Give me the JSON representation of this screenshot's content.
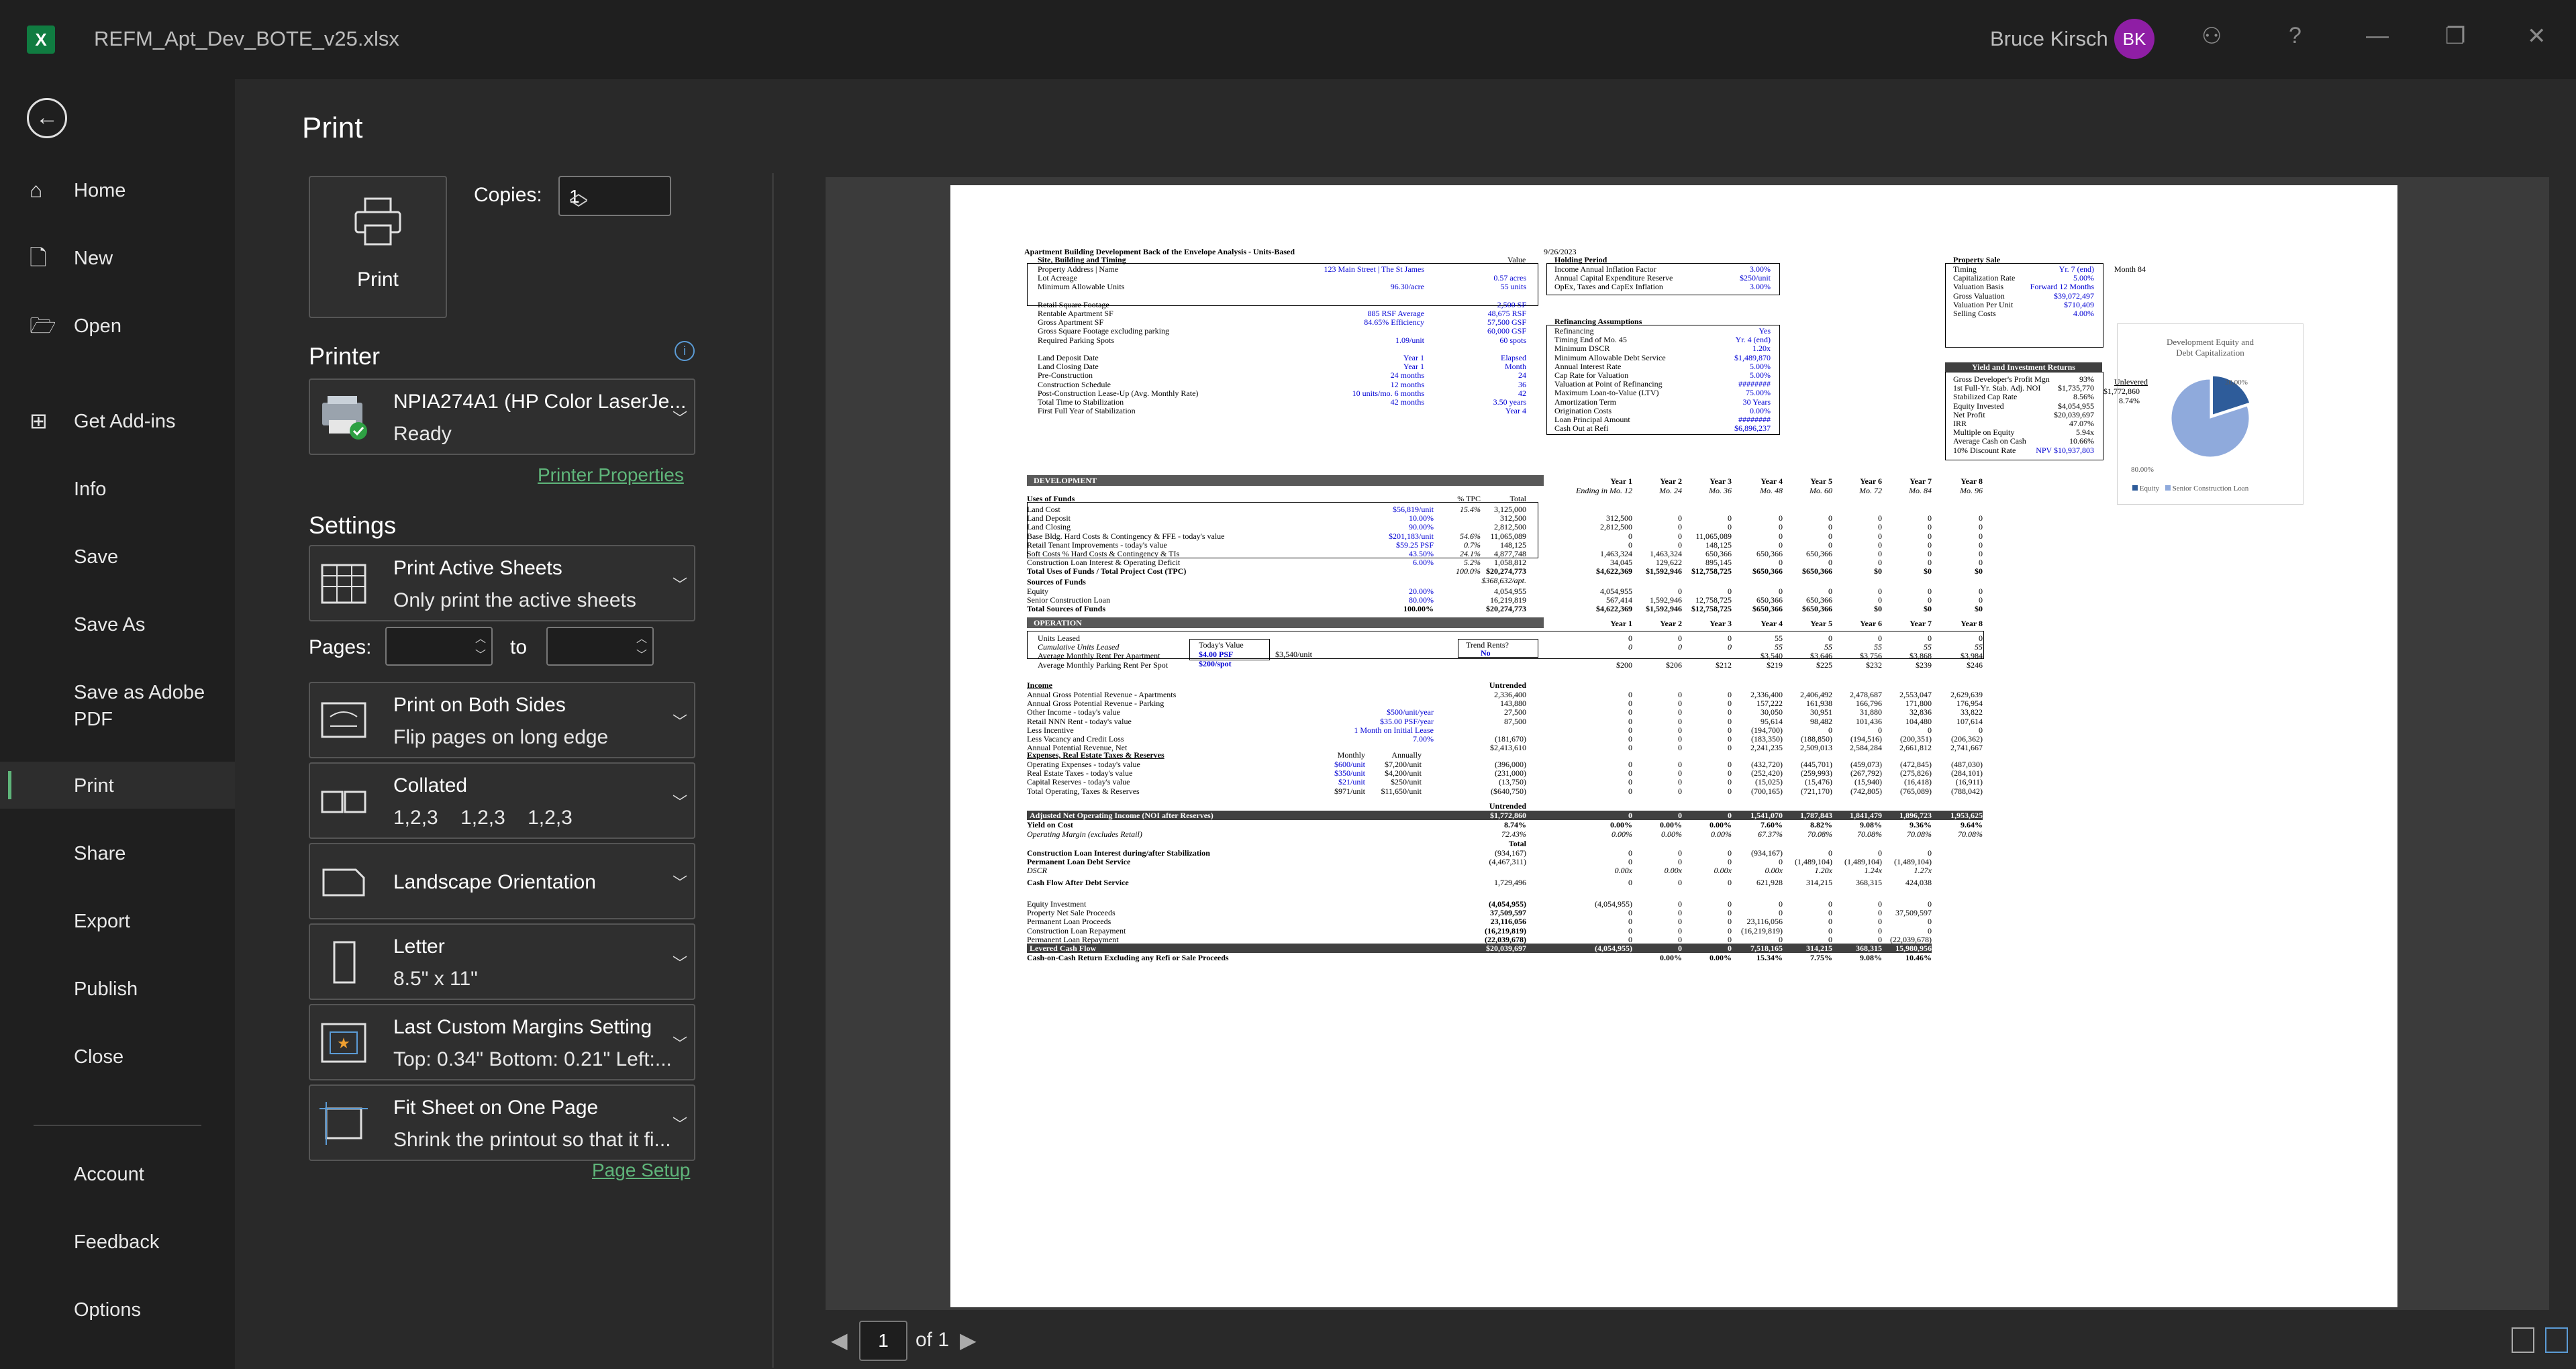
{
  "window": {
    "title": "REFM_Apt_Dev_BOTE_v25.xlsx",
    "user_name": "Bruce Kirsch",
    "user_initials": "BK",
    "help_glyph": "?",
    "minimize_glyph": "—",
    "restore_glyph": "❐",
    "close_glyph": "✕"
  },
  "nav": {
    "back_glyph": "←",
    "items": [
      {
        "label": "Home",
        "icon": "home-icon"
      },
      {
        "label": "New",
        "icon": "new-doc-icon"
      },
      {
        "label": "Open",
        "icon": "open-folder-icon"
      },
      {
        "label": "Get Add-ins",
        "icon": "add-ins-icon"
      },
      {
        "label": "Info"
      },
      {
        "label": "Save"
      },
      {
        "label": "Save As"
      },
      {
        "label": "Save as Adobe",
        "label2": "PDF"
      },
      {
        "label": "Print"
      },
      {
        "label": "Share"
      },
      {
        "label": "Export"
      },
      {
        "label": "Publish"
      },
      {
        "label": "Close"
      },
      {
        "label": "Account"
      },
      {
        "label": "Feedback"
      },
      {
        "label": "Options"
      }
    ]
  },
  "print": {
    "heading": "Print",
    "button_label": "Print",
    "copies_label": "Copies:",
    "copies_value": "1",
    "printer_heading": "Printer",
    "printer_name": "NPIA274A1 (HP Color LaserJe...",
    "printer_status": "Ready",
    "printer_properties": "Printer Properties",
    "settings_heading": "Settings",
    "pages_label": "Pages:",
    "to_label": "to",
    "settings": [
      {
        "title": "Print Active Sheets",
        "sub": "Only print the active sheets"
      },
      {
        "title": "Print on Both Sides",
        "sub": "Flip pages on long edge"
      },
      {
        "title": "Collated",
        "sub": "1,2,3    1,2,3    1,2,3"
      },
      {
        "title": "Landscape Orientation",
        "sub": ""
      },
      {
        "title": "Letter",
        "sub": "8.5\" x 11\""
      },
      {
        "title": "Last Custom Margins Setting",
        "sub": "Top: 0.34\" Bottom: 0.21\" Left:..."
      },
      {
        "title": "Fit Sheet on One Page",
        "sub": "Shrink the printout so that it fi..."
      }
    ],
    "page_setup": "Page Setup",
    "page_current": "1",
    "page_of": "of 1"
  },
  "sheet": {
    "title": "Apartment Building Development Back of the Envelope Analysis - Units-Based",
    "date": "9/26/2023",
    "site_header": "Site, Building and Timing",
    "value_header": "Value",
    "site_rows": [
      [
        "Property Address | Name",
        "123 Main Street | The St James",
        ""
      ],
      [
        "Lot Acreage",
        "",
        "0.57 acres"
      ],
      [
        "Minimum Allowable Units",
        "96.30/acre",
        "55 units"
      ],
      [
        "",
        "",
        ""
      ],
      [
        "Retail Square Footage",
        "",
        "2,500 SF"
      ],
      [
        "Rentable Apartment SF",
        "885 RSF  Average",
        "48,675 RSF"
      ],
      [
        "Gross Apartment SF",
        "84.65%  Efficiency",
        "57,500 GSF"
      ],
      [
        "Gross Square Footage excluding parking",
        "",
        "60,000 GSF"
      ],
      [
        "Required Parking Spots",
        "1.09/unit",
        "60 spots"
      ],
      [
        "",
        "",
        ""
      ],
      [
        "Land Deposit Date",
        "Year 1",
        "Elapsed"
      ],
      [
        "Land Closing Date",
        "Year 1",
        "Month"
      ],
      [
        "Pre-Construction",
        "24 months",
        "24"
      ],
      [
        "Construction Schedule",
        "12 months",
        "36"
      ],
      [
        "Post-Construction Lease-Up (Avg. Monthly Rate)",
        "10 units/mo.  6 months",
        "42"
      ],
      [
        "Total Time to Stabilization",
        "42 months",
        "3.50 years"
      ],
      [
        "First Full Year of Stabilization",
        "",
        "Year 4"
      ]
    ],
    "holding_header": "Holding Period",
    "holding_rows": [
      [
        "Income Annual Inflation Factor",
        "3.00%"
      ],
      [
        "Annual Capital Expenditure Reserve",
        "$250/unit"
      ],
      [
        "OpEx, Taxes and CapEx Inflation",
        "3.00%"
      ]
    ],
    "refi_header": "Refinancing Assumptions",
    "refi_rows": [
      [
        "Refinancing",
        "Yes"
      ],
      [
        "Timing    End of Mo. 45",
        "Yr. 4  (end)"
      ],
      [
        "Minimum DSCR",
        "1.20x"
      ],
      [
        "Minimum Allowable Debt Service",
        "$1,489,870"
      ],
      [
        "Annual Interest Rate",
        "5.00%"
      ],
      [
        "Cap Rate for Valuation",
        "5.00%"
      ],
      [
        "Valuation at Point of Refinancing",
        "########"
      ],
      [
        "Maximum Loan-to-Value (LTV)",
        "75.00%"
      ],
      [
        "Amortization Term",
        "30 Years"
      ],
      [
        "Origination Costs",
        "0.00%"
      ],
      [
        "Loan Principal Amount",
        "########"
      ],
      [
        "Cash Out at Refi",
        "$6,896,237"
      ]
    ],
    "sale_header": "Property Sale",
    "sale_rows": [
      [
        "Timing",
        "Yr. 7 (end)"
      ],
      [
        "Capitalization Rate",
        "5.00%"
      ],
      [
        "Valuation Basis",
        "Forward 12 Months"
      ],
      [
        "Gross Valuation",
        "$39,072,497"
      ],
      [
        "Valuation Per Unit",
        "$710,409"
      ],
      [
        "Selling Costs",
        "4.00%"
      ]
    ],
    "month_note": "Month 84",
    "yield_header": "Yield and Investment Returns",
    "unlevered_label": "Unlevered",
    "yield_rows": [
      [
        "Gross Developer's Profit Mgn",
        "93%"
      ],
      [
        "1st Full-Yr. Stab. Adj. NOI",
        "$1,735,770"
      ],
      [
        "Stabilized Cap Rate",
        "8.56%"
      ],
      [
        "Equity Invested",
        "$4,054,955"
      ],
      [
        "Net Profit",
        "$20,039,697"
      ],
      [
        "IRR",
        "47.07%"
      ],
      [
        "Multiple on Equity",
        "5.94x"
      ],
      [
        "Average Cash on Cash",
        "10.66%"
      ],
      [
        "10% Discount Rate",
        "NPV $10,937,803"
      ]
    ],
    "unlev_values": [
      "$1,772,860",
      "8.74%"
    ],
    "dev_header": "DEVELOPMENT",
    "year_headers": [
      "Year 1",
      "Year 2",
      "Year 3",
      "Year 4",
      "Year 5",
      "Year 6",
      "Year 7",
      "Year 8"
    ],
    "month_sub": [
      "Ending in Mo. 12",
      "Mo. 24",
      "Mo. 36",
      "Mo. 48",
      "Mo. 60",
      "Mo. 72",
      "Mo. 84",
      "Mo. 96"
    ],
    "uses_header": "Uses of Funds",
    "pct_tpc": "% TPC",
    "total_label": "Total",
    "uses_rows": [
      [
        "Land Cost",
        "$56,819/unit",
        "15.4%",
        "3,125,000",
        [
          "",
          "",
          "",
          "",
          "",
          "",
          "",
          ""
        ]
      ],
      [
        "  Land Deposit",
        "10.00%",
        "",
        "312,500",
        [
          "312,500",
          "0",
          "0",
          "0",
          "0",
          "0",
          "0",
          "0"
        ]
      ],
      [
        "  Land Closing",
        "90.00%",
        "",
        "2,812,500",
        [
          "2,812,500",
          "0",
          "0",
          "0",
          "0",
          "0",
          "0",
          "0"
        ]
      ],
      [
        "Base Bldg. Hard Costs & Contingency & FFE - today's value",
        "$201,183/unit",
        "54.6%",
        "11,065,089",
        [
          "0",
          "0",
          "11,065,089",
          "0",
          "0",
          "0",
          "0",
          "0"
        ]
      ],
      [
        "Retail Tenant Improvements - today's value",
        "$59.25 PSF",
        "0.7%",
        "148,125",
        [
          "0",
          "0",
          "148,125",
          "0",
          "0",
          "0",
          "0",
          "0"
        ]
      ],
      [
        "Soft Costs % Hard Costs & Contingency & TIs",
        "43.50%",
        "24.1%",
        "4,877,748",
        [
          "1,463,324",
          "1,463,324",
          "650,366",
          "650,366",
          "650,366",
          "0",
          "0",
          "0"
        ]
      ],
      [
        "Construction Loan Interest & Operating Deficit",
        "6.00%",
        "5.2%",
        "1,058,812",
        [
          "34,045",
          "129,622",
          "895,145",
          "0",
          "0",
          "0",
          "0",
          "0"
        ]
      ],
      [
        "Total Uses of Funds / Total Project Cost (TPC)",
        "",
        "100.0%",
        "$20,274,773",
        [
          "$4,622,369",
          "$1,592,946",
          "$12,758,725",
          "$650,366",
          "$650,366",
          "$0",
          "$0",
          "$0"
        ]
      ]
    ],
    "tpc_per_unit": "$368,632/apt.",
    "sources_header": "Sources of Funds",
    "sources_rows": [
      [
        "Equity",
        "20.00%",
        "4,054,955",
        [
          "4,054,955",
          "0",
          "0",
          "0",
          "0",
          "0",
          "0",
          "0"
        ]
      ],
      [
        "Senior Construction Loan",
        "80.00%",
        "16,219,819",
        [
          "567,414",
          "1,592,946",
          "12,758,725",
          "650,366",
          "650,366",
          "0",
          "0",
          "0"
        ]
      ],
      [
        "Total Sources of Funds",
        "100.00%",
        "$20,274,773",
        [
          "$4,622,369",
          "$1,592,946",
          "$12,758,725",
          "$650,366",
          "$650,366",
          "$0",
          "$0",
          "$0"
        ]
      ]
    ],
    "op_header": "OPERATION",
    "lease_rows": [
      [
        "Units Leased",
        [
          "0",
          "0",
          "0",
          "55",
          "0",
          "0",
          "0",
          "0"
        ]
      ],
      [
        "Cumulative Units Leased",
        [
          "0",
          "0",
          "0",
          "55",
          "55",
          "55",
          "55",
          "55"
        ]
      ],
      [
        "Average Monthly Rent Per Apartment",
        [
          "",
          "",
          "",
          "$3,540",
          "$3,646",
          "$3,756",
          "$3,868",
          "$3,984"
        ]
      ],
      [
        "Average Monthly Parking Rent Per Spot",
        [
          "$200",
          "$206",
          "$212",
          "$219",
          "$225",
          "$232",
          "$239",
          "$246"
        ]
      ]
    ],
    "todays_value": "Today's Value",
    "rent_psf": "$4.00 PSF",
    "rent_unit": "$3,540/unit",
    "parking_rent": "$200/spot",
    "trend_rents": "Trend Rents?",
    "trend_no": "No",
    "income_header": "Income",
    "untrended": "Untrended",
    "income_rows": [
      [
        "Annual Gross Potential Revenue - Apartments",
        "",
        "2,336,400",
        [
          "0",
          "0",
          "0",
          "2,336,400",
          "2,406,492",
          "2,478,687",
          "2,553,047",
          "2,629,639"
        ]
      ],
      [
        "Annual Gross Potential Revenue - Parking",
        "",
        "143,880",
        [
          "0",
          "0",
          "0",
          "157,222",
          "161,938",
          "166,796",
          "171,800",
          "176,954"
        ]
      ],
      [
        "Other Income - today's value",
        "$500/unit/year",
        "27,500",
        [
          "0",
          "0",
          "0",
          "30,050",
          "30,951",
          "31,880",
          "32,836",
          "33,822"
        ]
      ],
      [
        "Retail NNN Rent - today's value",
        "$35.00 PSF/year",
        "87,500",
        [
          "0",
          "0",
          "0",
          "95,614",
          "98,482",
          "101,436",
          "104,480",
          "107,614"
        ]
      ],
      [
        "Less Incentive",
        "1 Month on Initial Lease",
        "",
        [
          "0",
          "0",
          "0",
          "(194,700)",
          "0",
          "0",
          "0",
          "0"
        ]
      ],
      [
        "Less Vacancy and Credit Loss",
        "7.00%",
        "(181,670)",
        [
          "0",
          "0",
          "0",
          "(183,350)",
          "(188,850)",
          "(194,516)",
          "(200,351)",
          "(206,362)"
        ]
      ],
      [
        "Annual Potential Revenue, Net",
        "",
        "$2,413,610",
        [
          "0",
          "0",
          "0",
          "2,241,235",
          "2,509,013",
          "2,584,284",
          "2,661,812",
          "2,741,667"
        ]
      ]
    ],
    "exp_header": "Expenses, Real Estate Taxes & Reserves",
    "monthly": "Monthly",
    "annually": "Annually",
    "exp_rows": [
      [
        "Operating Expenses - today's value",
        "$600/unit",
        "$7,200/unit",
        "(396,000)",
        [
          "0",
          "0",
          "0",
          "(432,720)",
          "(445,701)",
          "(459,073)",
          "(472,845)",
          "(487,030)"
        ]
      ],
      [
        "Real Estate Taxes - today's value",
        "$350/unit",
        "$4,200/unit",
        "(231,000)",
        [
          "0",
          "0",
          "0",
          "(252,420)",
          "(259,993)",
          "(267,792)",
          "(275,826)",
          "(284,101)"
        ]
      ],
      [
        "Capital Reserves - today's value",
        "$21/unit",
        "$250/unit",
        "(13,750)",
        [
          "0",
          "0",
          "0",
          "(15,025)",
          "(15,476)",
          "(15,940)",
          "(16,418)",
          "(16,911)"
        ]
      ],
      [
        "Total Operating, Taxes & Reserves",
        "$971/unit",
        "$11,650/unit",
        "($640,750)",
        [
          "0",
          "0",
          "0",
          "(700,165)",
          "(721,170)",
          "(742,805)",
          "(765,089)",
          "(788,042)"
        ]
      ]
    ],
    "untrended2": "Untrended",
    "noi_row": [
      "Adjusted Net Operating Income (NOI after Reserves)",
      "$1,772,860",
      [
        "0",
        "0",
        "0",
        "1,541,070",
        "1,787,843",
        "1,841,479",
        "1,896,723",
        "1,953,625"
      ]
    ],
    "yoc_row": [
      "Yield on Cost",
      "8.74%",
      [
        "0.00%",
        "0.00%",
        "0.00%",
        "7.60%",
        "8.82%",
        "9.08%",
        "9.36%",
        "9.64%"
      ]
    ],
    "opm_row": [
      "Operating Margin (excludes Retail)",
      "72.43%",
      [
        "0.00%",
        "0.00%",
        "0.00%",
        "67.37%",
        "70.08%",
        "70.08%",
        "70.08%",
        "70.08%"
      ]
    ],
    "total2": "Total",
    "debt_rows": [
      [
        "Construction Loan Interest during/after Stabilization",
        "(934,167)",
        [
          "0",
          "0",
          "0",
          "(934,167)",
          "0",
          "0",
          "0",
          ""
        ]
      ],
      [
        "Permanent Loan Debt Service",
        "(4,467,311)",
        [
          "0",
          "0",
          "0",
          "0",
          "(1,489,104)",
          "(1,489,104)",
          "(1,489,104)",
          ""
        ]
      ],
      [
        "DSCR",
        "",
        [
          "0.00x",
          "0.00x",
          "0.00x",
          "0.00x",
          "1.20x",
          "1.24x",
          "1.27x",
          ""
        ]
      ],
      [
        "Cash Flow After Debt Service",
        "1,729,496",
        [
          "0",
          "0",
          "0",
          "621,928",
          "314,215",
          "368,315",
          "424,038",
          ""
        ]
      ]
    ],
    "eq_rows": [
      [
        "Equity Investment",
        "(4,054,955)",
        [
          "(4,054,955)",
          "0",
          "0",
          "0",
          "0",
          "0",
          "0",
          ""
        ]
      ],
      [
        "Property Net Sale Proceeds",
        "37,509,597",
        [
          "0",
          "0",
          "0",
          "0",
          "0",
          "0",
          "37,509,597",
          ""
        ]
      ],
      [
        "Permanent Loan Proceeds",
        "23,116,056",
        [
          "0",
          "0",
          "0",
          "23,116,056",
          "0",
          "0",
          "0",
          ""
        ]
      ],
      [
        "Construction Loan Repayment",
        "(16,219,819)",
        [
          "0",
          "0",
          "0",
          "(16,219,819)",
          "0",
          "0",
          "0",
          ""
        ]
      ],
      [
        "Permanent Loan Repayment",
        "(22,039,678)",
        [
          "0",
          "0",
          "0",
          "0",
          "0",
          "0",
          "(22,039,678)",
          ""
        ]
      ]
    ],
    "lcf_row": [
      "Levered Cash Flow",
      "$20,039,697",
      [
        "(4,054,955)",
        "0",
        "0",
        "7,518,165",
        "314,215",
        "368,315",
        "15,980,956",
        ""
      ]
    ],
    "coc_row": [
      "Cash-on-Cash Return Excluding any Refi or Sale Proceeds",
      "",
      [
        "",
        "0.00%",
        "0.00%",
        "15.34%",
        "7.75%",
        "9.08%",
        "10.46%",
        ""
      ]
    ],
    "pie": {
      "title1": "Development Equity and",
      "title2": "Debt Capitalization",
      "equity_pct": 20.0,
      "loan_pct": 80.0,
      "equity_label": "20.00%",
      "loan_label": "80.00%",
      "legend_equity": "Equity",
      "legend_loan": "Senior Construction Loan",
      "equity_color": "#2e5c9a",
      "loan_color": "#8faadc"
    }
  }
}
